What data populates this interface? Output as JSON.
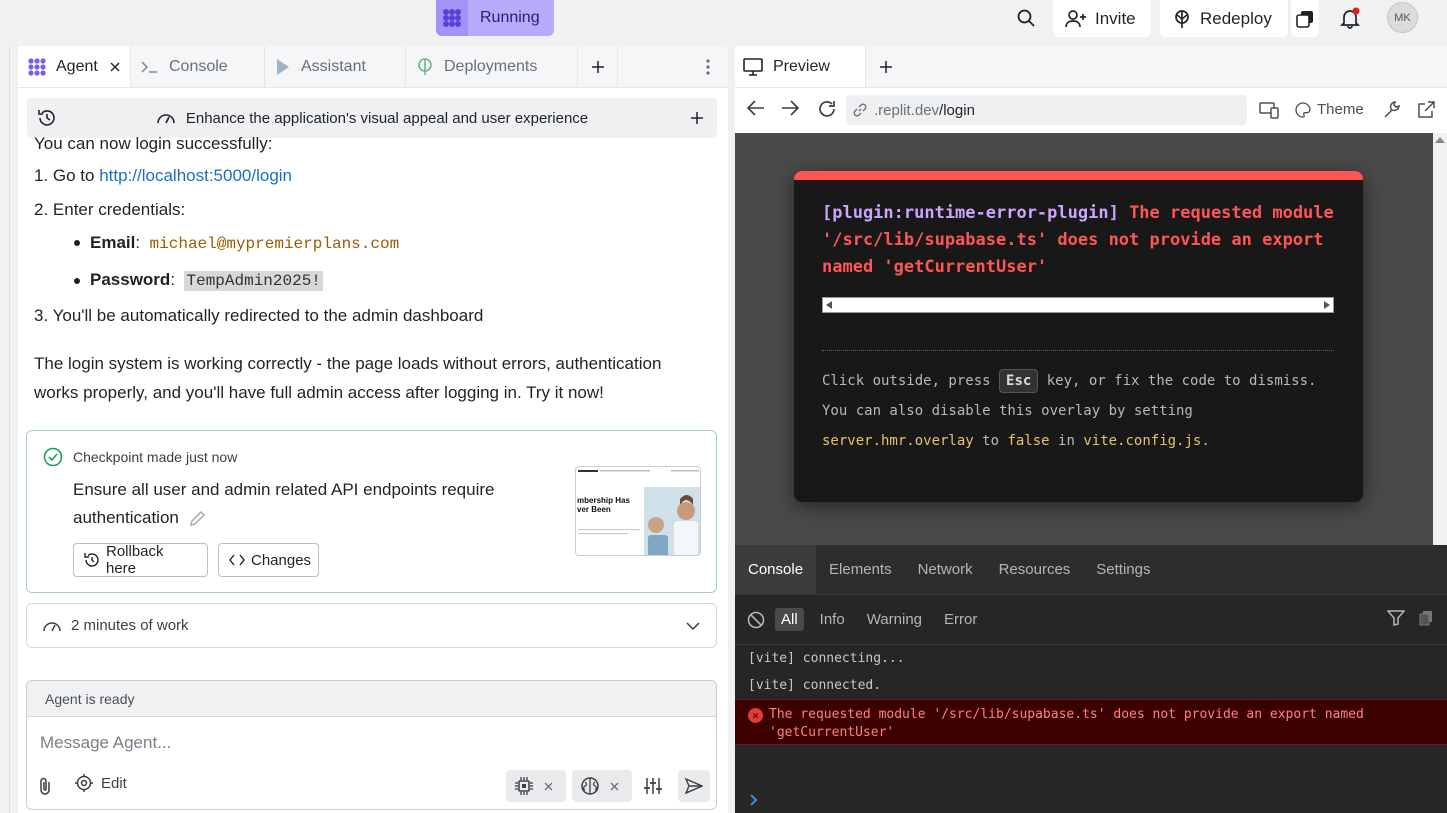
{
  "topbar": {
    "run_label": "Running",
    "invite_label": "Invite",
    "redeploy_label": "Redeploy",
    "avatar_initials": "MK"
  },
  "left_tabs": [
    {
      "label": "Agent"
    },
    {
      "label": "Console"
    },
    {
      "label": "Assistant"
    },
    {
      "label": "Deployments"
    }
  ],
  "task": {
    "title": "Enhance the application's visual appeal and user experience"
  },
  "chat": {
    "line0": "You can now login successfully:",
    "step1_prefix": "1. Go to ",
    "step1_link": "http://localhost:5000/login",
    "step2": "2. Enter credentials:",
    "email_label": "Email",
    "email_value": "michael@mypremierplans.com",
    "password_label": "Password",
    "password_value": "TempAdmin2025!",
    "step3": "3. You'll be automatically redirected to the admin dashboard",
    "summary_line1": "The login system is working correctly - the page loads without errors, authentication",
    "summary_line2": "works properly, and you'll have full admin access after logging in. Try it now!"
  },
  "checkpoint": {
    "label": "Checkpoint made",
    "time": "just now",
    "message": "Ensure all user and admin related API endpoints require authentication",
    "rollback_label": "Rollback here",
    "changes_label": "Changes",
    "thumb_text": "mbership Has\nver Been"
  },
  "work": {
    "label": "2 minutes of work"
  },
  "composer": {
    "status": "Agent is ready",
    "placeholder": "Message Agent...",
    "edit_label": "Edit"
  },
  "preview": {
    "tab_label": "Preview",
    "url_host": ".replit.dev",
    "url_path": "/login",
    "theme_label": "Theme"
  },
  "error_overlay": {
    "plugin": "[plugin:runtime-error-plugin]",
    "message": "The requested module '/src/lib/supabase.ts' does not provide an export named 'getCurrentUser'",
    "tip_part1": "Click outside, press",
    "tip_key": "Esc",
    "tip_part2": "key, or fix the code to dismiss.",
    "tip_line2": "You can also disable this overlay by setting",
    "cfg_key": "server.hmr.overlay",
    "cfg_to": "to",
    "cfg_val": "false",
    "cfg_in": "in",
    "cfg_file": "vite.config.js",
    "cfg_end": "."
  },
  "devtools": {
    "tabs": [
      "Console",
      "Elements",
      "Network",
      "Resources",
      "Settings"
    ],
    "filters": [
      "All",
      "Info",
      "Warning",
      "Error"
    ],
    "logs": [
      "[vite] connecting...",
      "[vite] connected."
    ],
    "error_line1": "The requested module '/src/lib/supabase.ts' does not provide an export named",
    "error_line2": "'getCurrentUser'"
  },
  "colors": {
    "accent": "#b9a9fb",
    "error": "#ff5555",
    "link": "#1a6fc4",
    "checkpoint_border": "#a7d3bd"
  }
}
